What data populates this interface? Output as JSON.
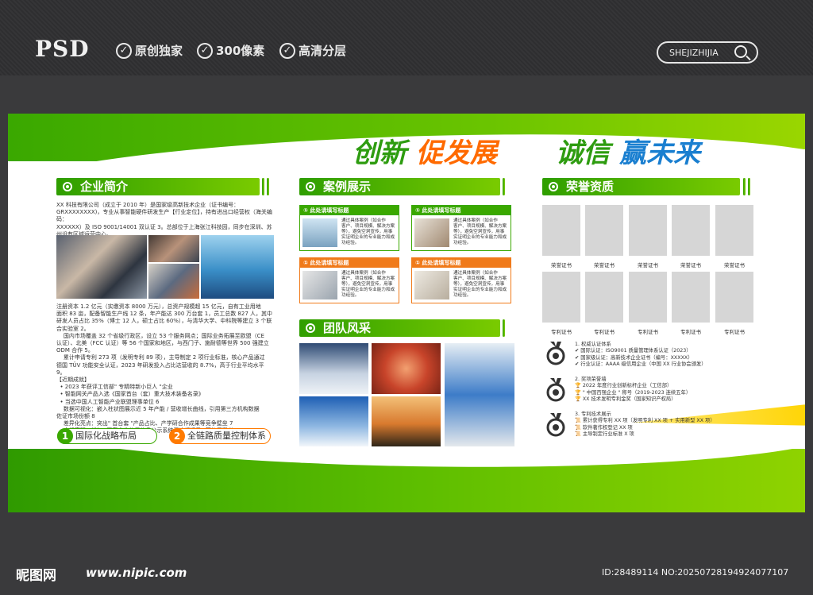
{
  "header": {
    "psd": "PSD",
    "features": [
      "原创独家",
      "300像素",
      "高清分层"
    ],
    "search_label": "SHEJIZHIJIA"
  },
  "slogan": {
    "part1": "创新",
    "part2": "促发展",
    "part3": "诚信",
    "part4": "赢未来"
  },
  "sections": {
    "company": "企业简介",
    "cases": "案例展示",
    "team": "团队风采",
    "honors": "荣誉资质"
  },
  "company": {
    "intro": "XX 科技有限公司（成立于 2010 年）是国家级高新技术企业（证书编号：\nGRXXXXXXXX)，专业从事智能硬件研发生产【行业定位】，持有进出口经营权（海关编码：\nXXXXXX）及 ISO 9001/14001 双认证 3。总部位于上海张江科技园，同步在深圳、苏\n州设有区域运营中心。",
    "body": "注册资本 1.2 亿元（实缴资本 8000 万元），总资产规模超 15 亿元，自有工业用地\n面积 83 亩，配备智能生产线 12 条，年产能达 300 万台套 1，员工总数 827 人，其中\n研发人员占比 35%（博士 12 人，硕士占比 60%），与清华大学、中科院等建立 3 个联\n合实验室 2。\n    国内市场覆盖 32 个省级行政区，设立 53 个服务网点；国际业务拓展至欧盟（CE\n认证）、北美（FCC 认证）等 56 个国家和地区，与西门子、施耐德等世界 500 强建立\nODM 合作 5。\n    累计申请专利 273 项（发明专利 89 项），主导制定 2 项行业标准，核心产品通过\n德国 TÜV 功能安全认证，2023 年研发投入占比达营收的 8.7%，高于行业平均水平 9。\n【近期成就】\n  • 2023 年获评工信部\" 专精特新小巨人 \"企业\n  • 智能网关产品入选《国家首台（套）重大技术装备名录》\n  • 当选中国人工智能产业联盟理事单位 6\n    数据可视化：嵌入柱状图展示近 5 年产能 / 营收增长曲线，引用第三方机构数据\n佐证市场份额 8\n    差异化亮点：突出\" 首台套 \"产品占比、产学研合作成果等竞争壁垒 7\n    合规声明：增加\" 国家企业信用信息公示系统无违规记录 \"等信用背书 4",
    "pill1": "国际化战略布局",
    "pill2": "全链路质量控制体系",
    "pill1_num": "1",
    "pill2_num": "2"
  },
  "cases": {
    "items": [
      {
        "title": "① 此处请填写标题",
        "text": "通过具体案例（如合作\n客户、项目规模、解决方案\n等），避免空洞宣传，用事\n实证明企业的专业能力和成\n功经验。"
      },
      {
        "title": "① 此处请填写标题",
        "text": "通过具体案例（如合作\n客户、项目规模、解决方案\n等），避免空洞宣传，用事\n实证明企业的专业能力和成\n功经验。"
      },
      {
        "title": "① 此处请填写标题",
        "text": "通过具体案例（如合作\n客户、项目规模、解决方案\n等），避免空洞宣传，用事\n实证明企业的专业能力和成\n功经验。"
      },
      {
        "title": "① 此处请填写标题",
        "text": "通过具体案例（如合作\n客户、项目规模、解决方案\n等），避免空洞宣传，用事\n实证明企业的专业能力和成\n功经验。"
      }
    ]
  },
  "honors": {
    "row1_label": "荣誉证书",
    "row2_label": "专利证书",
    "list1": "1. 权威认证体系\n✔ 国际认证：ISO9001 质量管理体系认证（2023）\n✔ 国家级认证：高新技术企业证书（编号：XXXXX）\n✔ 行业认证：AAAA 级信用企业（中国 XX 行业协会颁发）",
    "list2": "2. 奖项荣誉墙\n🏆 2022 年度行业创新标杆企业（工信部）\n🏆 \" 中国百强企业 \" 称号（2019-2023 连续五年）\n🏆 XX 技术发明专利金奖（国家知识产权局）",
    "list3": "3. 专利技术展示\n📜 累计获得专利 XX 项（发明专利 XX 项 + 实用新型 XX 项）\n📜 软件著作权登记 XX 项\n📜 主导制定行业标准 X 项"
  },
  "footer": {
    "logo": "昵图网",
    "url": "www.nipic.com",
    "id": "ID:28489114 NO:20250728194924077107"
  },
  "colors": {
    "green": "#3aa800",
    "orange": "#ff6a00",
    "blue": "#1a7fd0"
  }
}
